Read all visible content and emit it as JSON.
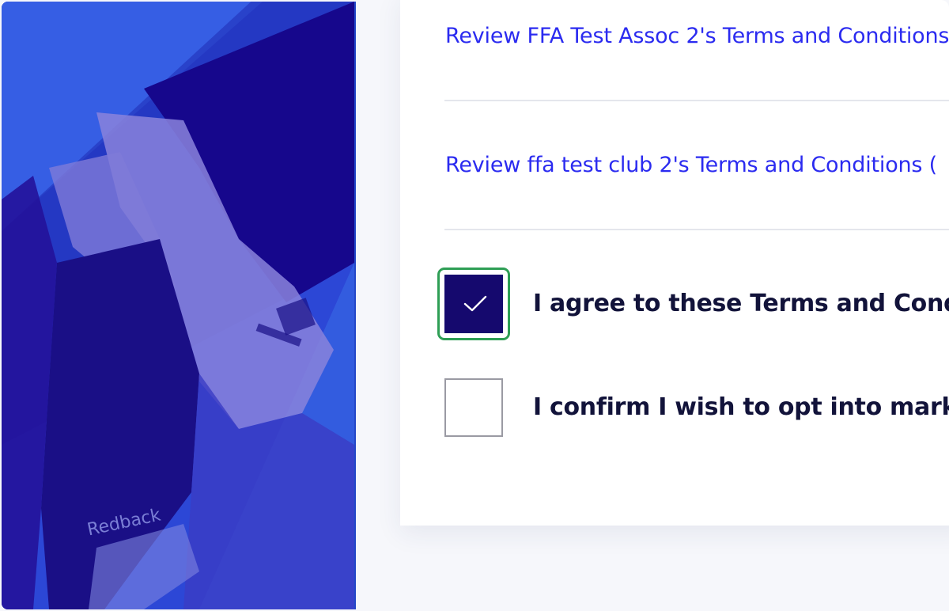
{
  "hero": {
    "image_icon": "athlete-photo",
    "tint_color": "#2a3fd0",
    "sleeve_text": "Redback"
  },
  "terms": {
    "links": [
      {
        "label": "Review FFA Test Assoc 2's Terms and Conditions"
      },
      {
        "label": "Review ffa test club 2's Terms and Conditions ("
      }
    ],
    "agree": {
      "label": "I agree to these Terms and Conditions",
      "checked": true
    },
    "marketing": {
      "label": "I confirm I wish to opt into marketing",
      "checked": false
    }
  },
  "colors": {
    "link": "#2b2bf0",
    "checkbox_checked": "#15096e",
    "focus_ring": "#2e9e55",
    "label_text": "#12133a"
  }
}
